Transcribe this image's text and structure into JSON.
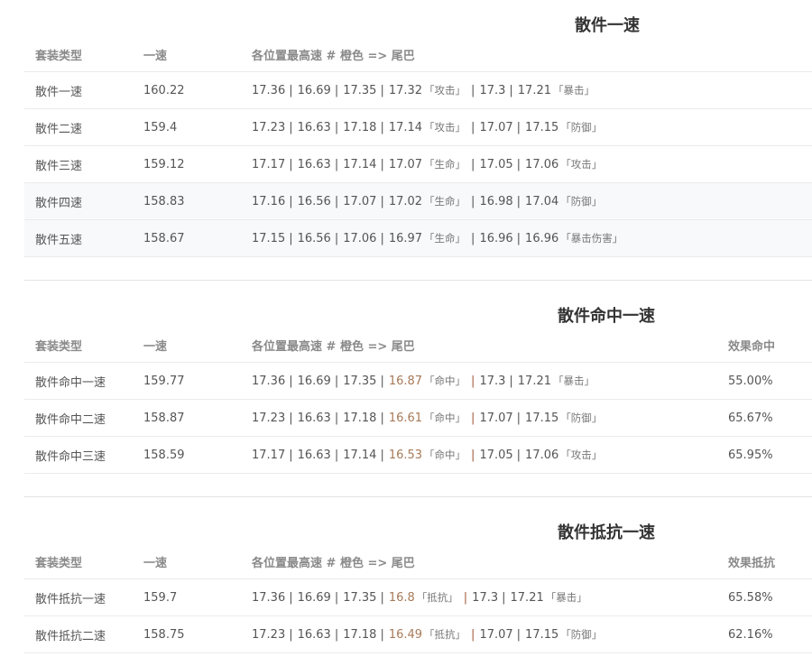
{
  "sections": [
    {
      "title": "散件一速",
      "headers": {
        "type": "套装类型",
        "speed": "一速",
        "positions": "各位置最高速 # 橙色 => 尾巴",
        "extra": ""
      },
      "rows": [
        {
          "type": "散件一速",
          "speed": "160.22",
          "vals": [
            "17.36",
            "16.69",
            "17.35",
            "17.32",
            "「攻击」",
            "17.3",
            "17.21",
            "「暴击」"
          ],
          "extra": ""
        },
        {
          "type": "散件二速",
          "speed": "159.4",
          "vals": [
            "17.23",
            "16.63",
            "17.18",
            "17.14",
            "「攻击」",
            "17.07",
            "17.15",
            "「防御」"
          ],
          "extra": ""
        },
        {
          "type": "散件三速",
          "speed": "159.12",
          "vals": [
            "17.17",
            "16.63",
            "17.14",
            "17.07",
            "「生命」",
            "17.05",
            "17.06",
            "「攻击」"
          ],
          "extra": ""
        },
        {
          "type": "散件四速",
          "speed": "158.83",
          "vals": [
            "17.16",
            "16.56",
            "17.07",
            "17.02",
            "「生命」",
            "16.98",
            "17.04",
            "「防御」"
          ],
          "extra": ""
        },
        {
          "type": "散件五速",
          "speed": "158.67",
          "vals": [
            "17.15",
            "16.56",
            "17.06",
            "16.97",
            "「生命」",
            "16.96",
            "16.96",
            "「暴击伤害」"
          ],
          "extra": ""
        }
      ]
    },
    {
      "title": "散件命中一速",
      "headers": {
        "type": "套装类型",
        "speed": "一速",
        "positions": "各位置最高速 # 橙色 => 尾巴",
        "extra": "效果命中"
      },
      "rows": [
        {
          "type": "散件命中一速",
          "speed": "159.77",
          "vals": [
            "17.36",
            "16.69",
            "17.35",
            "16.87",
            "「命中」",
            "17.3",
            "17.21",
            "「暴击」"
          ],
          "extra": "55.00%"
        },
        {
          "type": "散件命中二速",
          "speed": "158.87",
          "vals": [
            "17.23",
            "16.63",
            "17.18",
            "16.61",
            "「命中」",
            "17.07",
            "17.15",
            "「防御」"
          ],
          "extra": "65.67%"
        },
        {
          "type": "散件命中三速",
          "speed": "158.59",
          "vals": [
            "17.17",
            "16.63",
            "17.14",
            "16.53",
            "「命中」",
            "17.05",
            "17.06",
            "「攻击」"
          ],
          "extra": "65.95%"
        }
      ]
    },
    {
      "title": "散件抵抗一速",
      "headers": {
        "type": "套装类型",
        "speed": "一速",
        "positions": "各位置最高速 # 橙色 => 尾巴",
        "extra": "效果抵抗"
      },
      "rows": [
        {
          "type": "散件抵抗一速",
          "speed": "159.7",
          "vals": [
            "17.36",
            "16.69",
            "17.35",
            "16.8",
            "「抵抗」",
            "17.3",
            "17.21",
            "「暴击」"
          ],
          "extra": "65.58%"
        },
        {
          "type": "散件抵抗二速",
          "speed": "158.75",
          "vals": [
            "17.23",
            "16.63",
            "17.18",
            "16.49",
            "「抵抗」",
            "17.07",
            "17.15",
            "「防御」"
          ],
          "extra": "62.16%"
        }
      ]
    }
  ],
  "colors": {
    "tail_number": "#a77a58",
    "tail_separator": "#a15a3e",
    "row_alt_bg": "#f8f9fb"
  }
}
